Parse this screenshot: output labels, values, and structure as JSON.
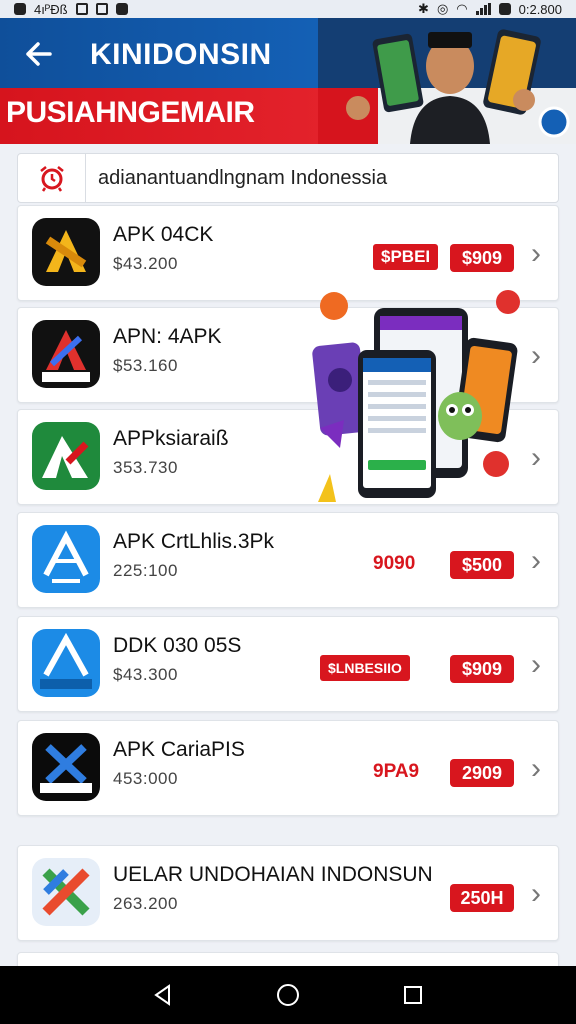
{
  "status_bar": {
    "left_text": "4ıᴾÐß",
    "time": "0:2.800"
  },
  "header": {
    "title": "KINIDONSIN",
    "subtitle": "PUSIAHNGEMAIR",
    "back_icon": "arrow-left-icon",
    "colors": {
      "blue": "#1460b5",
      "red": "#d6141d"
    }
  },
  "search": {
    "value": "adianantuandlngnam Indonessia",
    "icon": "alarm-icon"
  },
  "apps": [
    {
      "name": "APK 04CK",
      "size": "$43.200",
      "badge": "$PBEI",
      "price": "$909"
    },
    {
      "name": "APN: 4APK",
      "size": "$53.160"
    },
    {
      "name": "APPksiaraiß",
      "size": "353.730"
    },
    {
      "name": "APK CrtLhlis.3Pk",
      "size": "225:100",
      "badge_text": "9090",
      "price": "$500"
    },
    {
      "name": "DDK 030 05S",
      "size": "$43.300",
      "badge": "$LNBESIIO",
      "price": "$909"
    },
    {
      "name": "APK CariaPIS",
      "size": "453:000",
      "badge_text": "9PA9",
      "price": "2909"
    },
    {
      "name": "UELAR UNDOHAIAN INDONSUN",
      "size": "263.200",
      "price": "250H"
    }
  ],
  "nav": {
    "back": "nav-back-icon",
    "home": "nav-home-icon",
    "recents": "nav-recents-icon"
  },
  "accent_red": "#d8161e"
}
